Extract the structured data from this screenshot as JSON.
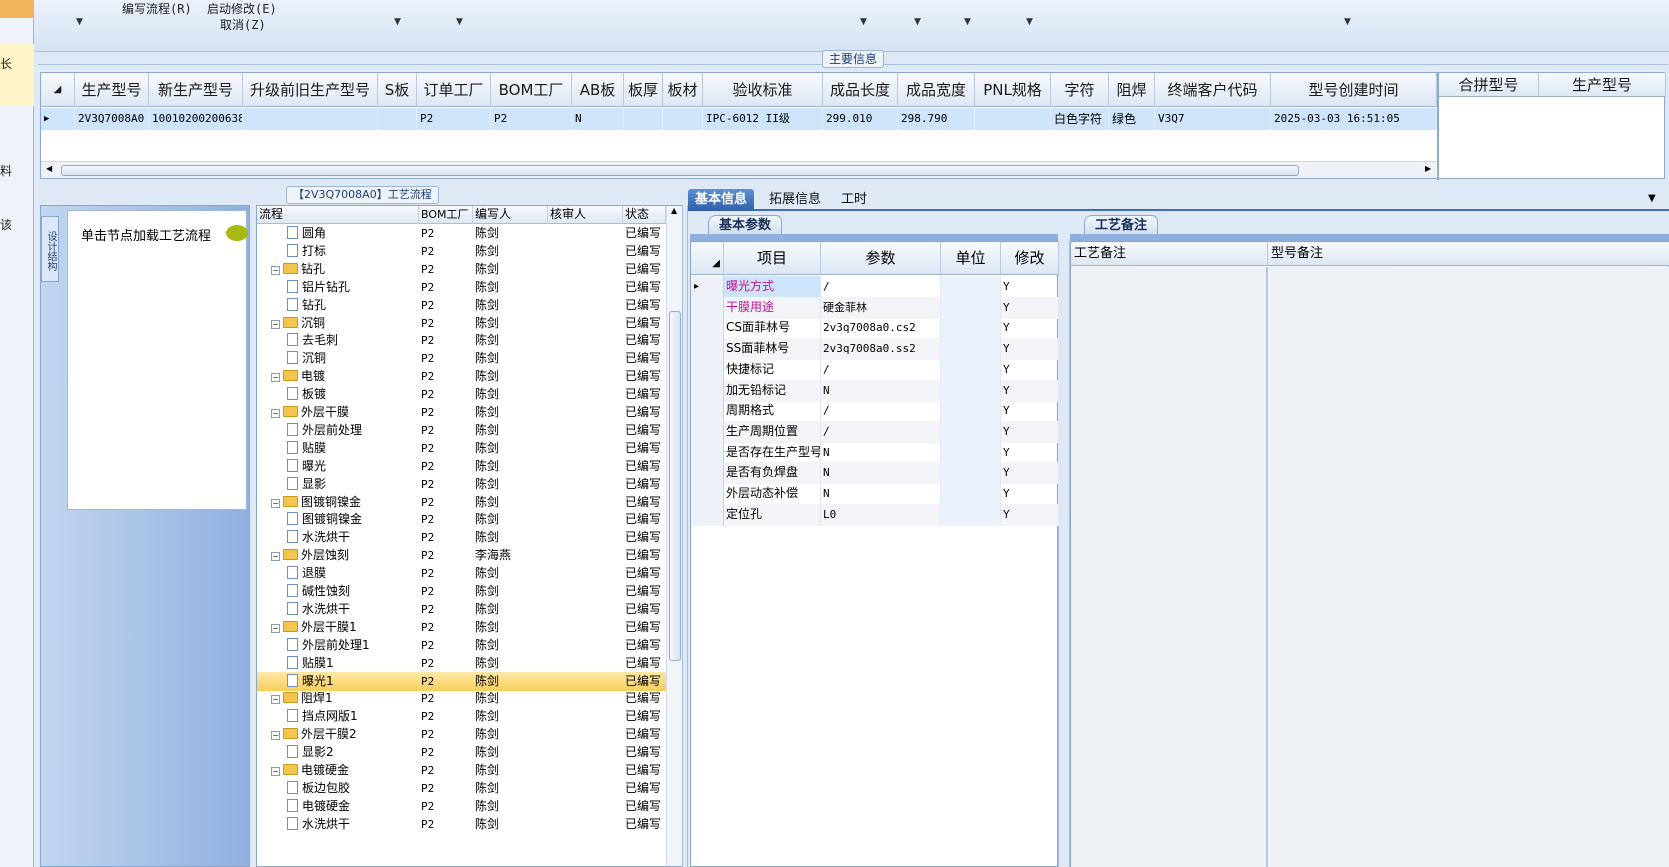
{
  "left_strip": {
    "labels": [
      "长",
      "料",
      "该"
    ]
  },
  "toolbar": {
    "items": [
      "编写流程(R)",
      "启动修改(E)",
      "取消(Z)"
    ]
  },
  "main_info": {
    "title": "主要信息",
    "columns": [
      "生产型号",
      "新生产型号",
      "升级前旧生产型号",
      "S板",
      "订单工厂",
      "BOM工厂",
      "AB板",
      "板厚",
      "板材",
      "验收标准",
      "成品长度",
      "成品宽度",
      "PNL规格",
      "字符",
      "阻焊",
      "终端客户代码",
      "型号创建时间"
    ],
    "row": [
      "2V3Q7008A0",
      "10010200200638",
      "",
      "",
      "P2",
      "P2",
      "N",
      "",
      "",
      "IPC-6012 II级",
      "299.010",
      "298.790",
      "",
      "白色字符",
      "绿色",
      "V3Q7",
      "2025-03-03 16:51:05"
    ],
    "side_columns": [
      "合拼型号",
      "生产型号"
    ]
  },
  "designer": {
    "tab": "设计结构",
    "hint": "单击节点加载工艺流程"
  },
  "process": {
    "title": "【2V3Q7008A0】工艺流程",
    "columns": [
      "流程",
      "BOM工厂",
      "编写人",
      "核审人",
      "状态"
    ],
    "rows": [
      {
        "level": 2,
        "type": "doc",
        "name": "圆角",
        "bom": "P2",
        "writer": "陈剑",
        "status": "已编写"
      },
      {
        "level": 2,
        "type": "doc",
        "name": "打标",
        "bom": "P2",
        "writer": "陈剑",
        "status": "已编写"
      },
      {
        "level": 1,
        "type": "folder",
        "name": "钻孔",
        "bom": "P2",
        "writer": "陈剑",
        "status": "已编写"
      },
      {
        "level": 2,
        "type": "doc",
        "name": "铝片钻孔",
        "bom": "P2",
        "writer": "陈剑",
        "status": "已编写"
      },
      {
        "level": 2,
        "type": "doc",
        "name": "钻孔",
        "bom": "P2",
        "writer": "陈剑",
        "status": "已编写"
      },
      {
        "level": 1,
        "type": "folder",
        "name": "沉铜",
        "bom": "P2",
        "writer": "陈剑",
        "status": "已编写"
      },
      {
        "level": 2,
        "type": "doc",
        "name": "去毛刺",
        "bom": "P2",
        "writer": "陈剑",
        "status": "已编写"
      },
      {
        "level": 2,
        "type": "doc",
        "name": "沉铜",
        "bom": "P2",
        "writer": "陈剑",
        "status": "已编写"
      },
      {
        "level": 1,
        "type": "folder",
        "name": "电镀",
        "bom": "P2",
        "writer": "陈剑",
        "status": "已编写"
      },
      {
        "level": 2,
        "type": "doc",
        "name": "板镀",
        "bom": "P2",
        "writer": "陈剑",
        "status": "已编写"
      },
      {
        "level": 1,
        "type": "folder",
        "name": "外层干膜",
        "bom": "P2",
        "writer": "陈剑",
        "status": "已编写"
      },
      {
        "level": 2,
        "type": "doc",
        "name": "外层前处理",
        "bom": "P2",
        "writer": "陈剑",
        "status": "已编写"
      },
      {
        "level": 2,
        "type": "doc",
        "name": "贴膜",
        "bom": "P2",
        "writer": "陈剑",
        "status": "已编写"
      },
      {
        "level": 2,
        "type": "doc",
        "name": "曝光",
        "bom": "P2",
        "writer": "陈剑",
        "status": "已编写"
      },
      {
        "level": 2,
        "type": "doc",
        "name": "显影",
        "bom": "P2",
        "writer": "陈剑",
        "status": "已编写"
      },
      {
        "level": 1,
        "type": "folder",
        "name": "图镀铜镍金",
        "bom": "P2",
        "writer": "陈剑",
        "status": "已编写"
      },
      {
        "level": 2,
        "type": "doc",
        "name": "图镀铜镍金",
        "bom": "P2",
        "writer": "陈剑",
        "status": "已编写"
      },
      {
        "level": 2,
        "type": "doc",
        "name": "水洗烘干",
        "bom": "P2",
        "writer": "陈剑",
        "status": "已编写"
      },
      {
        "level": 1,
        "type": "folder",
        "name": "外层蚀刻",
        "bom": "P2",
        "writer": "李海燕",
        "status": "已编写"
      },
      {
        "level": 2,
        "type": "doc",
        "name": "退膜",
        "bom": "P2",
        "writer": "陈剑",
        "status": "已编写"
      },
      {
        "level": 2,
        "type": "doc",
        "name": "碱性蚀刻",
        "bom": "P2",
        "writer": "陈剑",
        "status": "已编写"
      },
      {
        "level": 2,
        "type": "doc",
        "name": "水洗烘干",
        "bom": "P2",
        "writer": "陈剑",
        "status": "已编写"
      },
      {
        "level": 1,
        "type": "folder",
        "name": "外层干膜1",
        "bom": "P2",
        "writer": "陈剑",
        "status": "已编写"
      },
      {
        "level": 2,
        "type": "doc",
        "name": "外层前处理1",
        "bom": "P2",
        "writer": "陈剑",
        "status": "已编写"
      },
      {
        "level": 2,
        "type": "doc",
        "name": "贴膜1",
        "bom": "P2",
        "writer": "陈剑",
        "status": "已编写"
      },
      {
        "level": 2,
        "type": "doc",
        "name": "曝光1",
        "bom": "P2",
        "writer": "陈剑",
        "status": "已编写",
        "selected": true
      },
      {
        "level": 1,
        "type": "folder",
        "name": "阻焊1",
        "bom": "P2",
        "writer": "陈剑",
        "status": "已编写"
      },
      {
        "level": 2,
        "type": "doc",
        "name": "挡点网版1",
        "bom": "P2",
        "writer": "陈剑",
        "status": "已编写"
      },
      {
        "level": 1,
        "type": "folder",
        "name": "外层干膜2",
        "bom": "P2",
        "writer": "陈剑",
        "status": "已编写"
      },
      {
        "level": 2,
        "type": "doc",
        "name": "显影2",
        "bom": "P2",
        "writer": "陈剑",
        "status": "已编写"
      },
      {
        "level": 1,
        "type": "folder",
        "name": "电镀硬金",
        "bom": "P2",
        "writer": "陈剑",
        "status": "已编写"
      },
      {
        "level": 2,
        "type": "doc",
        "name": "板边包胶",
        "bom": "P2",
        "writer": "陈剑",
        "status": "已编写"
      },
      {
        "level": 2,
        "type": "doc",
        "name": "电镀硬金",
        "bom": "P2",
        "writer": "陈剑",
        "status": "已编写"
      },
      {
        "level": 2,
        "type": "doc",
        "name": "水洗烘干",
        "bom": "P2",
        "writer": "陈剑",
        "status": "已编写"
      }
    ]
  },
  "tabs": [
    "基本信息",
    "拓展信息",
    "工时"
  ],
  "basic_params": {
    "title": "基本参数",
    "columns": [
      "项目",
      "参数",
      "单位",
      "修改"
    ],
    "rows": [
      {
        "item": "曝光方式",
        "value": "/",
        "unit": "",
        "mod": "Y",
        "color": "#c0148c"
      },
      {
        "item": "干膜用途",
        "value": "硬金菲林",
        "unit": "",
        "mod": "Y",
        "color": "#c0148c"
      },
      {
        "item": "CS面菲林号",
        "value": "2v3q7008a0.cs2",
        "unit": "",
        "mod": "Y"
      },
      {
        "item": "SS面菲林号",
        "value": "2v3q7008a0.ss2",
        "unit": "",
        "mod": "Y"
      },
      {
        "item": "快捷标记",
        "value": "/",
        "unit": "",
        "mod": "Y"
      },
      {
        "item": "加无铅标记",
        "value": "N",
        "unit": "",
        "mod": "Y"
      },
      {
        "item": "周期格式",
        "value": "/",
        "unit": "",
        "mod": "Y"
      },
      {
        "item": "生产周期位置",
        "value": "/",
        "unit": "",
        "mod": "Y"
      },
      {
        "item": "是否存在生产型号",
        "value": "N",
        "unit": "",
        "mod": "Y"
      },
      {
        "item": "是否有负焊盘",
        "value": "N",
        "unit": "",
        "mod": "Y"
      },
      {
        "item": "外层动态补偿",
        "value": "N",
        "unit": "",
        "mod": "Y"
      },
      {
        "item": "定位孔",
        "value": "L0",
        "unit": "",
        "mod": "Y"
      }
    ]
  },
  "craft_notes": {
    "title": "工艺备注",
    "columns": [
      "工艺备注",
      "型号备注"
    ]
  }
}
